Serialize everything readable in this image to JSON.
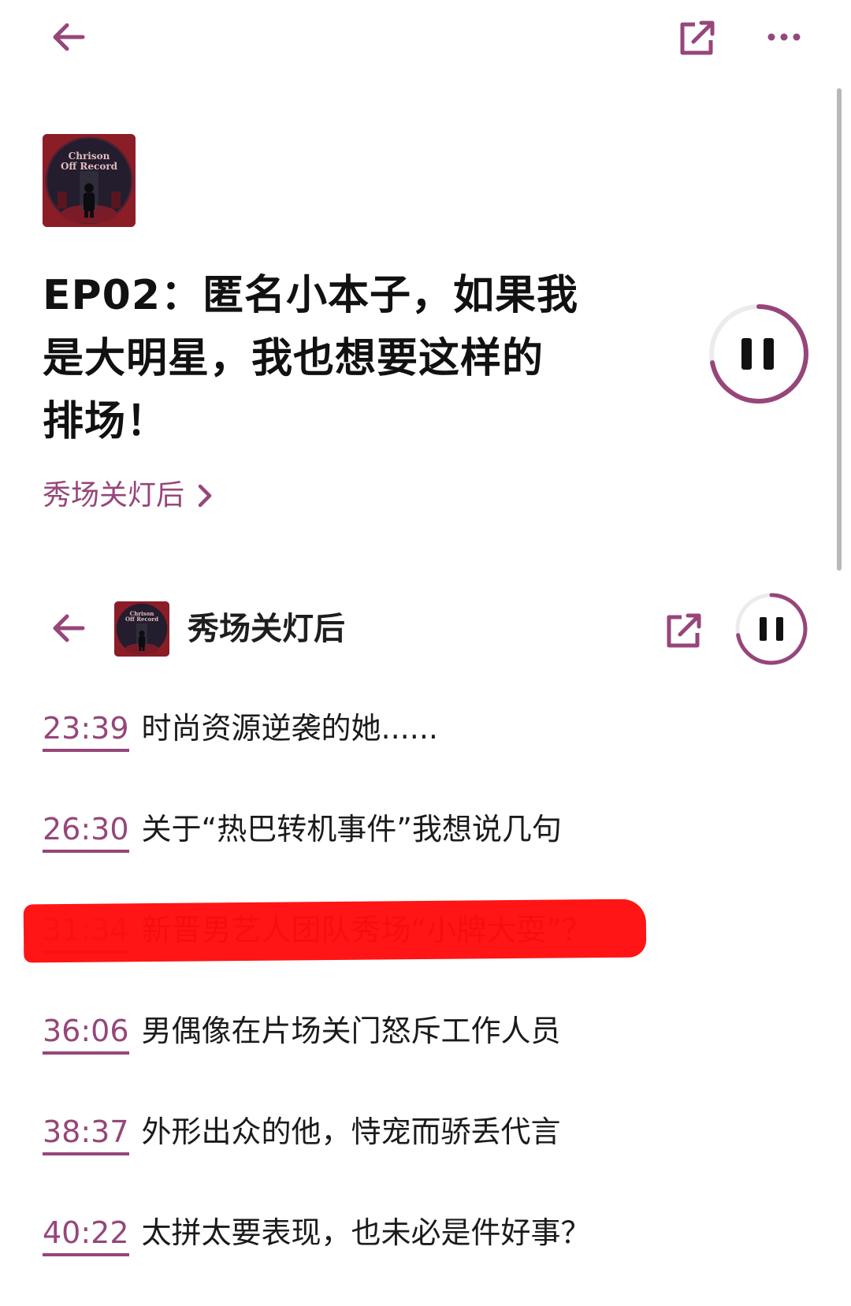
{
  "colors": {
    "accent": "#96467a",
    "title_text": "#111111",
    "body_text": "#1b1b1b",
    "marker": "#ff0d0d"
  },
  "top_bar": {
    "back_icon": "back-arrow-icon",
    "share_icon": "share-external-icon",
    "more_icon": "more-dots-icon"
  },
  "cover": {
    "text_line1": "Chrison",
    "text_line2": "Off Record"
  },
  "episode": {
    "title_line1": "EP02：匿名小本子，如果我",
    "title_line2": "是大明星，我也想要这样的",
    "title_line3": "排场！",
    "podcast_name": "秀场关灯后",
    "play_state": "playing",
    "progress": 0.72
  },
  "mini_header": {
    "title": "秀场关灯后",
    "back_icon": "back-arrow-icon",
    "share_icon": "share-external-icon",
    "progress": 0.72
  },
  "chapters": [
    {
      "time": "23:39",
      "title": "时尚资源逆袭的她......"
    },
    {
      "time": "26:30",
      "title": "关于“热巴转机事件”我想说几句"
    },
    {
      "time": "31:34",
      "title": "新晋男艺人团队秀场“小牌大耍”？",
      "marked": true
    },
    {
      "time": "36:06",
      "title": "男偶像在片场关门怒斥工作人员"
    },
    {
      "time": "38:37",
      "title": "外形出众的他，恃宠而骄丢代言"
    },
    {
      "time": "40:22",
      "title": "太拼太要表现，也未必是件好事？"
    }
  ]
}
